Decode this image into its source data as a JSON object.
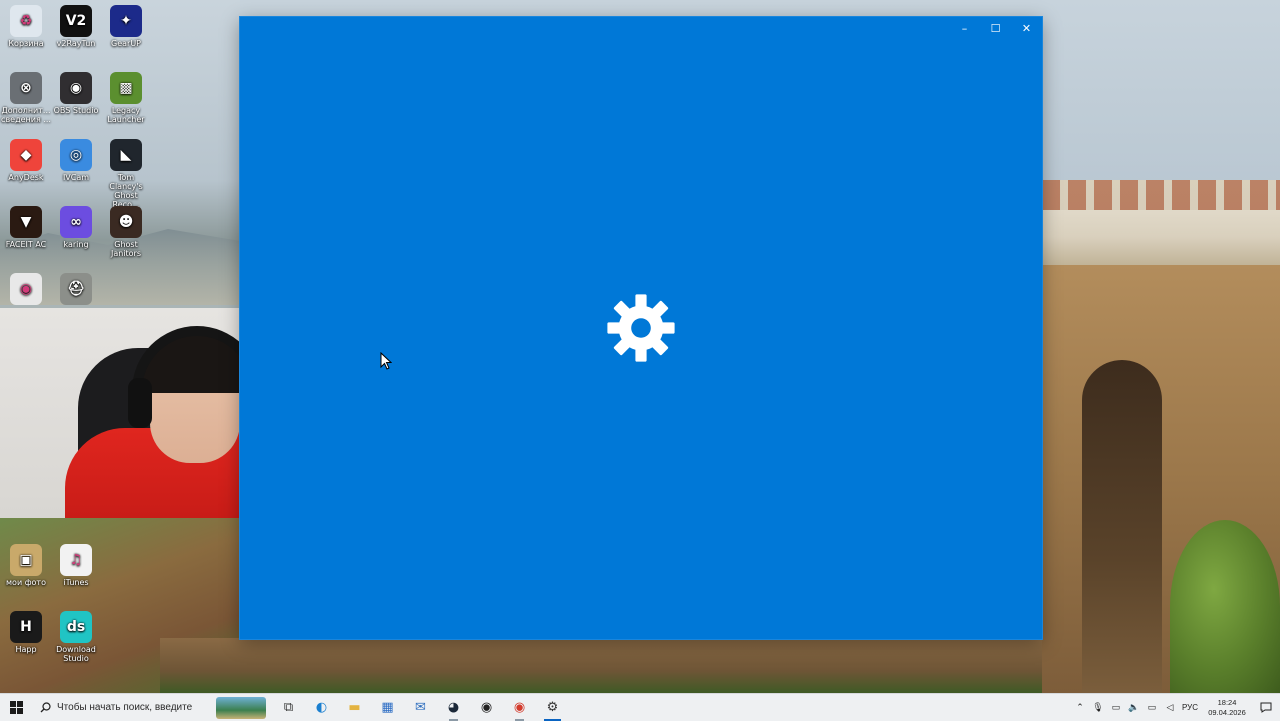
{
  "desktop": {
    "icons": [
      {
        "label": "Корзина",
        "icon": "recycle-bin-icon",
        "color": "#dfe7ee",
        "glyph": "♻"
      },
      {
        "label": "v2RayTun",
        "icon": "v2raytun-icon",
        "color": "#111111",
        "glyph": "V2"
      },
      {
        "label": "GearUP",
        "icon": "gearup-icon",
        "color": "#1c2a8a",
        "glyph": "✦"
      },
      {
        "label": "Дополнит... сведения ...",
        "icon": "info-app-icon",
        "color": "#6a6f74",
        "glyph": "⊗"
      },
      {
        "label": "OBS Studio",
        "icon": "obs-icon",
        "color": "#302e31",
        "glyph": "◉"
      },
      {
        "label": "Legacy Launcher",
        "icon": "minecraft-icon",
        "color": "#5b8f2f",
        "glyph": "▩"
      },
      {
        "label": "AnyDesk",
        "icon": "anydesk-icon",
        "color": "#ef443b",
        "glyph": "◆"
      },
      {
        "label": "IVCam",
        "icon": "ivcam-icon",
        "color": "#3a8be0",
        "glyph": "◎"
      },
      {
        "label": "Tom Clancy's Ghost Reco...",
        "icon": "ghost-recon-icon",
        "color": "#20262d",
        "glyph": "◣"
      },
      {
        "label": "FACEIT AC",
        "icon": "faceit-icon",
        "color": "#2a1a12",
        "glyph": "▼"
      },
      {
        "label": "karing",
        "icon": "karing-icon",
        "color": "#6c4de0",
        "glyph": "∞"
      },
      {
        "label": "Ghost Janitors",
        "icon": "ghost-janitors-icon",
        "color": "#3a2a22",
        "glyph": "☻"
      },
      {
        "label": "",
        "icon": "chrome-icon",
        "color": "#e8e8e8",
        "glyph": "◉"
      },
      {
        "label": "",
        "icon": "pubg-icon",
        "color": "#8c8f8a",
        "glyph": "⛑"
      },
      {
        "label": "мои фото",
        "icon": "photos-folder-icon",
        "color": "#c9a96a",
        "glyph": "▣"
      },
      {
        "label": "iTunes",
        "icon": "itunes-icon",
        "color": "#f2f2f2",
        "glyph": "♫"
      },
      {
        "label": "Happ",
        "icon": "happ-icon",
        "color": "#1a1a1a",
        "glyph": "H"
      },
      {
        "label": "Download Studio",
        "icon": "download-studio-icon",
        "color": "#20c4c4",
        "glyph": "ds"
      }
    ]
  },
  "window": {
    "loading_icon": "gear-icon",
    "controls": {
      "minimize": "–",
      "maximize": "☐",
      "close": "✕"
    },
    "background": "#0078d7"
  },
  "taskbar": {
    "search_placeholder": "Чтобы начать поиск, введите",
    "apps": [
      {
        "name": "task-view-button",
        "icon": "task-view-icon",
        "glyph": "⧉",
        "state": ""
      },
      {
        "name": "edge-button",
        "icon": "edge-icon",
        "glyph": "◐",
        "state": ""
      },
      {
        "name": "explorer-button",
        "icon": "folder-icon",
        "glyph": "▬",
        "state": ""
      },
      {
        "name": "store-button",
        "icon": "store-icon",
        "glyph": "▦",
        "state": ""
      },
      {
        "name": "mail-button",
        "icon": "mail-icon",
        "glyph": "✉",
        "state": ""
      },
      {
        "name": "steam-button",
        "icon": "steam-icon",
        "glyph": "◕",
        "state": "running"
      },
      {
        "name": "obs-taskbar-button",
        "icon": "obs-icon",
        "glyph": "◉",
        "state": ""
      },
      {
        "name": "chrome-taskbar-button",
        "icon": "chrome-icon",
        "glyph": "◉",
        "state": "running"
      },
      {
        "name": "settings-taskbar-button",
        "icon": "gear-icon",
        "glyph": "⚙",
        "state": "active"
      }
    ],
    "tray": {
      "language": "РУС",
      "time": "18:24",
      "date": "09.04.2026"
    }
  }
}
